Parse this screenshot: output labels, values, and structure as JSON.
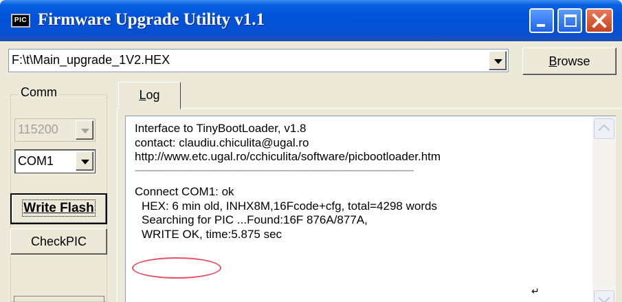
{
  "window": {
    "title": "Firmware Upgrade Utility v1.1",
    "icon_label": "PIC"
  },
  "file": {
    "path": "F:\\t\\Main_upgrade_1V2.HEX",
    "browse_label_first": "B",
    "browse_label_rest": "rowse"
  },
  "comm": {
    "group_label": "Comm",
    "baud": "115200",
    "port": "COM1"
  },
  "buttons": {
    "write_flash_first": "W",
    "write_flash_rest": "rite Flash",
    "check_pic": "CheckPIC"
  },
  "tabs": {
    "log_first": "L",
    "log_rest": "og"
  },
  "log": {
    "line1": "Interface to TinyBootLoader, v1.8",
    "line2": "contact: claudiu.chiculita@ugal.ro",
    "line3": "http://www.etc.ugal.ro/cchiculita/software/picbootloader.htm",
    "separator": "------------------------------------------------------------------------------------------------------------------------------------------------------------------------------",
    "line4": "Connect COM1: ok",
    "line5": "HEX: 6 min old, INHX8M,16Fcode+cfg, total=4298 words",
    "line6": "Searching for PIC ...Found:16F 876A/877A,",
    "line7": "WRITE OK,  time:5.875 sec",
    "return_glyph": "↵"
  }
}
